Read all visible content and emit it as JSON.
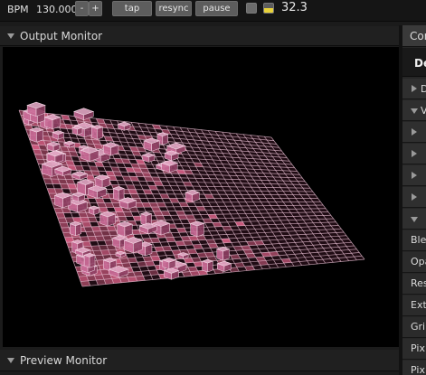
{
  "toolbar": {
    "bpm_label": "BPM",
    "bpm_value": "130.000",
    "minus_label": "-",
    "plus_label": "+",
    "tap_label": "tap",
    "resync_label": "resync",
    "pause_label": "pause",
    "fps_value": "32.3",
    "beat_indicator_color": "#e8d23a"
  },
  "output_monitor": {
    "title": "Output Monitor"
  },
  "preview_monitor": {
    "title": "Preview Monitor"
  },
  "sidebar": {
    "tab_label": "Cor",
    "header_label": "De",
    "sections": [
      {
        "label": "D",
        "state": "collapsed"
      },
      {
        "label": "V",
        "state": "expanded"
      },
      {
        "label": "",
        "state": "collapsed"
      },
      {
        "label": "",
        "state": "collapsed"
      },
      {
        "label": "",
        "state": "collapsed"
      },
      {
        "label": "",
        "state": "collapsed"
      },
      {
        "label": "",
        "state": "expanded"
      }
    ],
    "properties": [
      "Ble",
      "Opa",
      "Res",
      "Ext",
      "Gri",
      "Pix",
      "Pix"
    ]
  },
  "colors": {
    "accent_pink": "#c86a96",
    "grid_line": "#f2c8dc"
  }
}
